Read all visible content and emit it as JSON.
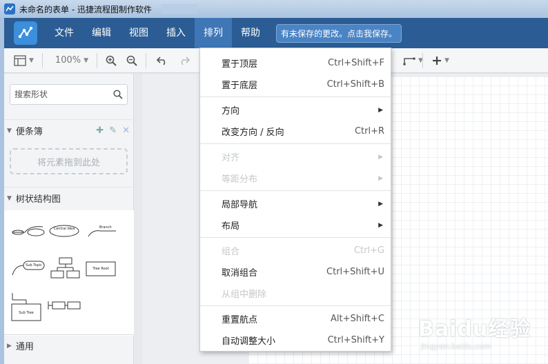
{
  "window": {
    "title": "未命名的表单 - 迅捷流程图制作软件"
  },
  "menubar": {
    "items": [
      "文件",
      "编辑",
      "视图",
      "插入",
      "排列",
      "帮助"
    ],
    "active": "排列",
    "unsaved_notice": "有未保存的更改。点击我保存。"
  },
  "toolbar": {
    "zoom": "100%"
  },
  "sidebar": {
    "search_placeholder": "搜索形状",
    "scratchpad": {
      "title": "便条簿",
      "drop_hint": "将元素拖到此处"
    },
    "tree_panel": {
      "title": "树状结构图"
    },
    "general_panel": {
      "title": "通用"
    },
    "shape_labels": [
      "Central Idea",
      "Branch",
      "Sub Topic",
      "Tree Root",
      "Sub Tree"
    ]
  },
  "arrange_menu": {
    "groups": [
      [
        {
          "label": "置于顶层",
          "shortcut": "Ctrl+Shift+F",
          "enabled": true
        },
        {
          "label": "置于底层",
          "shortcut": "Ctrl+Shift+B",
          "enabled": true
        }
      ],
      [
        {
          "label": "方向",
          "submenu": true,
          "enabled": true
        },
        {
          "label": "改变方向 / 反向",
          "shortcut": "Ctrl+R",
          "enabled": true
        }
      ],
      [
        {
          "label": "对齐",
          "submenu": true,
          "enabled": false
        },
        {
          "label": "等距分布",
          "submenu": true,
          "enabled": false
        }
      ],
      [
        {
          "label": "局部导航",
          "submenu": true,
          "enabled": true
        },
        {
          "label": "布局",
          "submenu": true,
          "enabled": true
        }
      ],
      [
        {
          "label": "组合",
          "shortcut": "Ctrl+G",
          "enabled": false
        },
        {
          "label": "取消组合",
          "shortcut": "Ctrl+Shift+U",
          "enabled": true
        },
        {
          "label": "从组中删除",
          "enabled": false
        }
      ],
      [
        {
          "label": "重置航点",
          "shortcut": "Alt+Shift+C",
          "enabled": true
        },
        {
          "label": "自动调整大小",
          "shortcut": "Ctrl+Shift+Y",
          "enabled": true
        }
      ]
    ]
  },
  "watermark": {
    "text": "Baidu经验",
    "url": "jingyan.baidu.com"
  }
}
